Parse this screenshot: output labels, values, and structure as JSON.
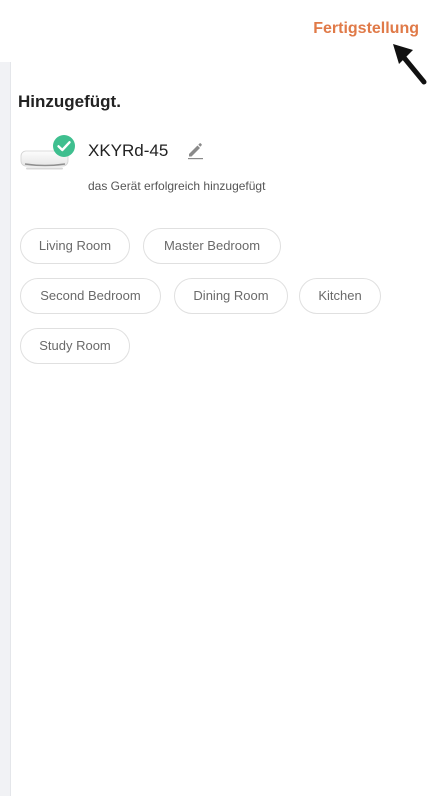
{
  "header": {
    "done_label": "Fertigstellung"
  },
  "page": {
    "title": "Hinzugefügt."
  },
  "device": {
    "name": "XKYRd-45",
    "status": "das Gerät erfolgreich hinzugefügt",
    "image_icon": "air-conditioner-icon",
    "check_icon": "check-circle-icon",
    "edit_icon": "pencil-icon"
  },
  "rooms": [
    {
      "label": "Living Room"
    },
    {
      "label": "Master Bedroom"
    },
    {
      "label": "Second Bedroom"
    },
    {
      "label": "Dining Room"
    },
    {
      "label": "Kitchen"
    },
    {
      "label": "Study Room"
    }
  ],
  "colors": {
    "accent": "#e07a48",
    "check": "#3fbf8f",
    "chip_border": "#e0e0e0",
    "chip_text": "#6a6a6a"
  }
}
